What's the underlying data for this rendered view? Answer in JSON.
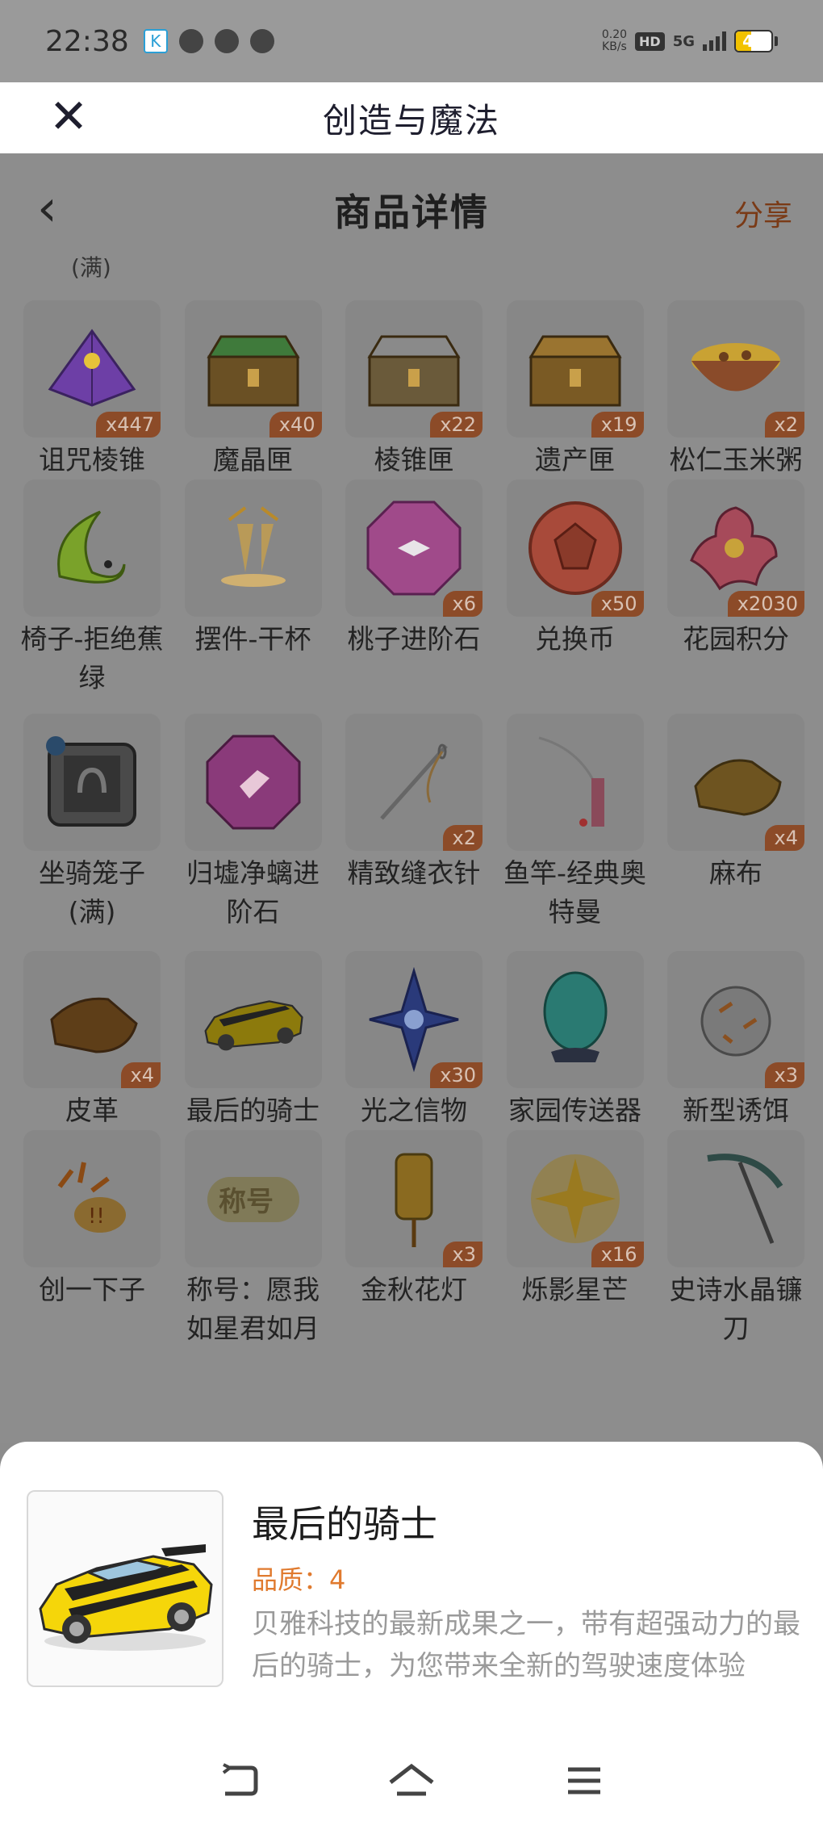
{
  "status_bar": {
    "time": "22:38",
    "net_speed_value": "0.20",
    "net_speed_unit": "KB/s",
    "hd_badge": "HD",
    "signal_label": "5G",
    "battery_level": "44",
    "battery_fill_percent": 44
  },
  "mini_program": {
    "title": "创造与魔法"
  },
  "navbar": {
    "title": "商品详情",
    "share_label": "分享",
    "cut_text": "(满)"
  },
  "icons": {
    "close": "close-icon",
    "back": "chevron-left-icon",
    "nav_back": "back-nav-icon",
    "nav_home": "home-nav-icon",
    "nav_menu": "menu-nav-icon"
  },
  "items": [
    {
      "name": "诅咒棱锥",
      "qty": "x447",
      "icon": "pyramid"
    },
    {
      "name": "魔晶匣",
      "qty": "x40",
      "icon": "chest-green"
    },
    {
      "name": "棱锥匣",
      "qty": "x22",
      "icon": "chest-silver"
    },
    {
      "name": "遗产匣",
      "qty": "x19",
      "icon": "chest-gold"
    },
    {
      "name": "松仁玉米粥",
      "qty": "x2",
      "icon": "bowl"
    },
    {
      "name": "椅子-拒绝蕉绿",
      "qty": "",
      "icon": "banana"
    },
    {
      "name": "摆件-干杯",
      "qty": "",
      "icon": "cheers"
    },
    {
      "name": "桃子进阶石",
      "qty": "x6",
      "icon": "gem-bow"
    },
    {
      "name": "兑换币",
      "qty": "x50",
      "icon": "coin"
    },
    {
      "name": "花园积分",
      "qty": "x2030",
      "icon": "flower"
    },
    {
      "name": "坐骑笼子(满)",
      "qty": "",
      "icon": "cage"
    },
    {
      "name": "归墟净螭进阶石",
      "qty": "",
      "icon": "gem-purple"
    },
    {
      "name": "精致缝衣针",
      "qty": "x2",
      "icon": "needle"
    },
    {
      "name": "鱼竿-经典奥特曼",
      "qty": "",
      "icon": "rod"
    },
    {
      "name": "麻布",
      "qty": "x4",
      "icon": "cloth"
    },
    {
      "name": "皮革",
      "qty": "x4",
      "icon": "leather"
    },
    {
      "name": "最后的骑士",
      "qty": "",
      "icon": "car"
    },
    {
      "name": "光之信物",
      "qty": "x30",
      "icon": "star-crystal"
    },
    {
      "name": "家园传送器",
      "qty": "",
      "icon": "egg"
    },
    {
      "name": "新型诱饵",
      "qty": "x3",
      "icon": "bait"
    },
    {
      "name": "创一下子",
      "qty": "",
      "icon": "sticker"
    },
    {
      "name": "称号：愿我如星君如月",
      "qty": "",
      "icon": "title"
    },
    {
      "name": "金秋花灯",
      "qty": "x3",
      "icon": "lantern"
    },
    {
      "name": "烁影星芒",
      "qty": "x16",
      "icon": "sparkle"
    },
    {
      "name": "史诗水晶镰刀",
      "qty": "",
      "icon": "scythe"
    }
  ],
  "detail": {
    "title": "最后的骑士",
    "quality": "品质：4",
    "description": "贝雅科技的最新成果之一，带有超强动力的最后的骑士，为您带来全新的驾驶速度体验"
  },
  "colors": {
    "accent": "#e07a2e",
    "qty_badge": "#8c4b28",
    "overlay": "#8d8d8d",
    "car_yellow": "#f5d60a"
  }
}
